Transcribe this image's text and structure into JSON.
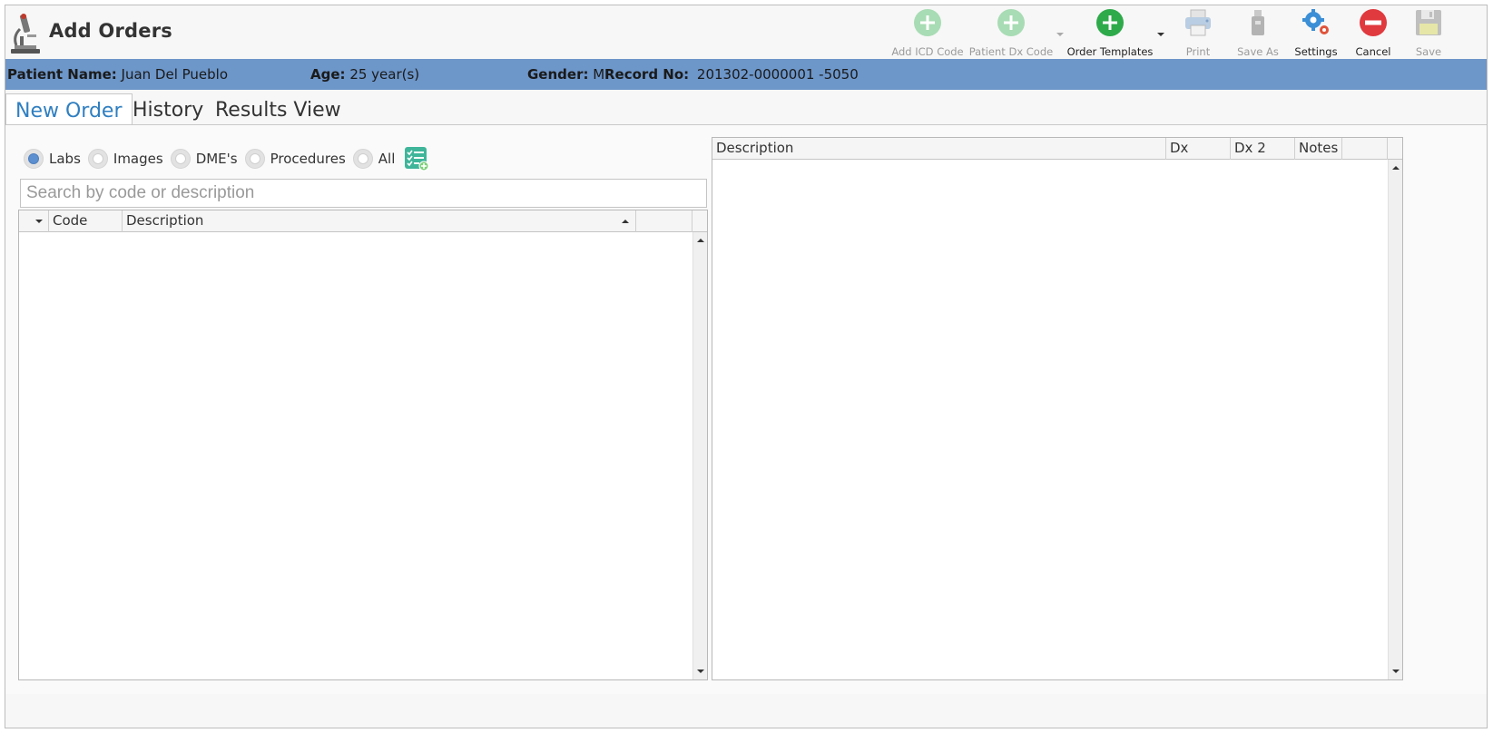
{
  "header": {
    "title": "Add Orders",
    "logo_icon": "microscope-icon"
  },
  "toolbar": {
    "add_icd_code": "Add ICD Code",
    "patient_dx_code": "Patient Dx Code",
    "order_templates": "Order Templates",
    "print": "Print",
    "save_as": "Save As",
    "settings": "Settings",
    "cancel": "Cancel",
    "save": "Save"
  },
  "patient": {
    "name_label": "Patient Name:",
    "name_value": "Juan Del Pueblo",
    "age_label": "Age:",
    "age_value": "25 year(s)",
    "gender_label": "Gender:",
    "gender_value": "M",
    "record_label": "Record No:",
    "record_value": "201302-0000001 -5050"
  },
  "tabs": [
    {
      "label": "New Order",
      "active": true
    },
    {
      "label": "History",
      "active": false
    },
    {
      "label": "Results View",
      "active": false
    }
  ],
  "filters": [
    {
      "label": "Labs",
      "checked": true
    },
    {
      "label": "Images",
      "checked": false
    },
    {
      "label": "DME's",
      "checked": false
    },
    {
      "label": "Procedures",
      "checked": false
    },
    {
      "label": "All",
      "checked": false
    }
  ],
  "search": {
    "placeholder": "Search by code or description",
    "value": ""
  },
  "left_grid": {
    "columns": [
      "Code",
      "Description"
    ]
  },
  "right_grid": {
    "columns": [
      "Description",
      "Dx",
      "Dx 2",
      "Notes"
    ]
  },
  "colors": {
    "patient_bar": "#6d96c9",
    "accent_tab": "#2f7fc1",
    "add_green": "#2eaa4a",
    "add_green_disabled": "#a8dcb4",
    "cancel_red": "#e0393e",
    "radio_checked": "#5b8fcf"
  }
}
